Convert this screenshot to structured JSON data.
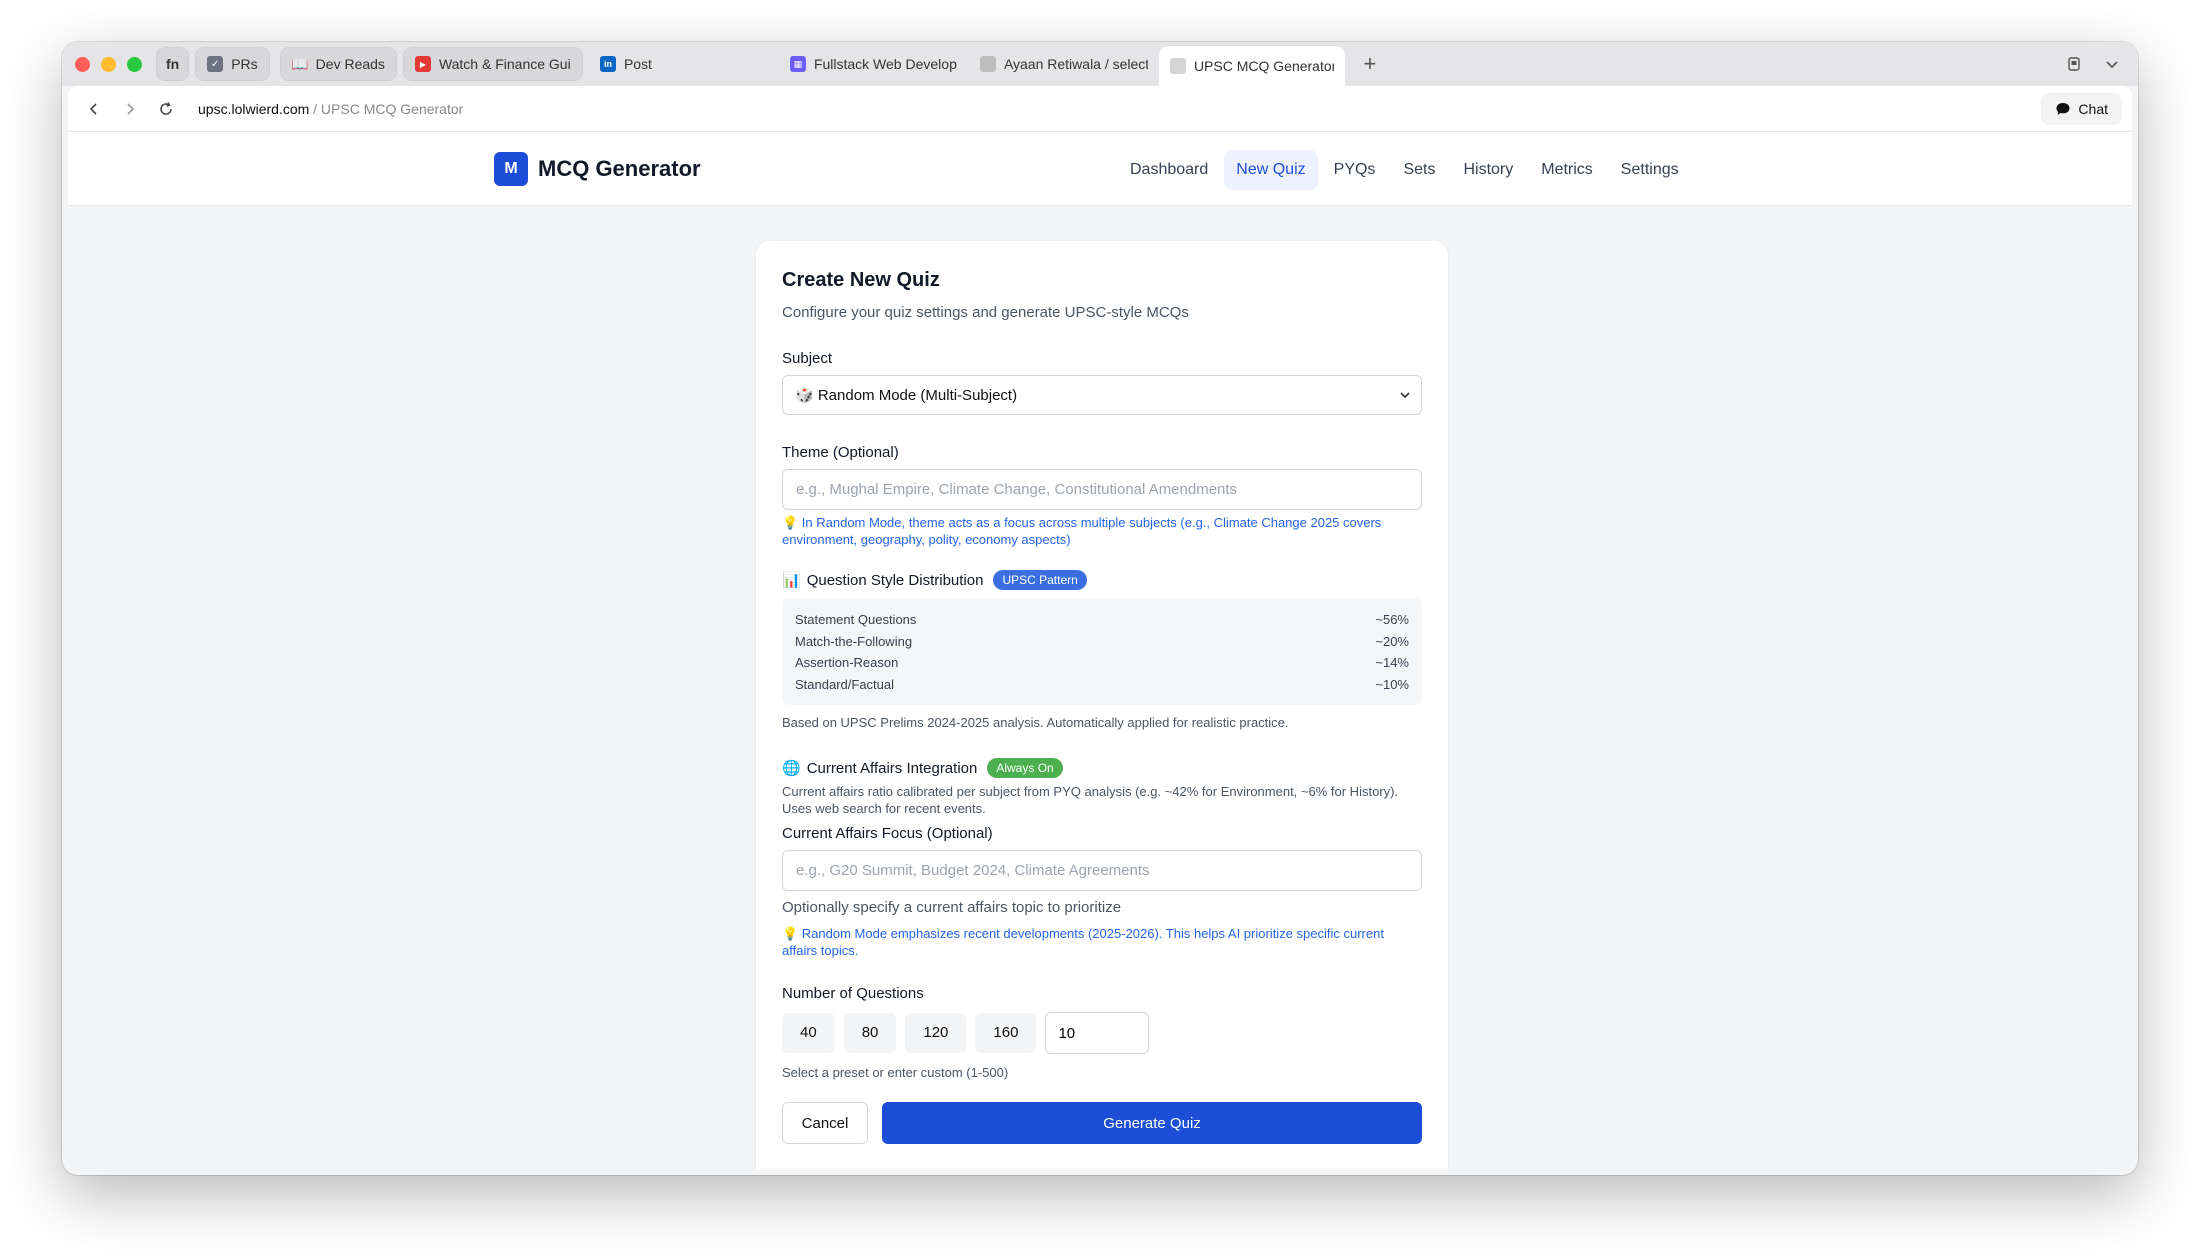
{
  "browser": {
    "tabs": [
      {
        "label": "fn",
        "pinned": true
      },
      {
        "label": "PRs",
        "pinned": true
      },
      {
        "label": "Dev Reads",
        "pinned": true
      },
      {
        "label": "Watch & Finance Guid",
        "pinned": true
      },
      {
        "label": "Post",
        "pinned": false
      },
      {
        "label": "Fullstack Web Develop",
        "pinned": false
      },
      {
        "label": "Ayaan Retiwala / select",
        "pinned": false
      },
      {
        "label": "UPSC MCQ Generator",
        "pinned": false,
        "active": true
      }
    ],
    "url_domain": "upsc.lolwierd.com",
    "url_path": " / UPSC MCQ Generator",
    "chat_label": "Chat"
  },
  "app": {
    "logo_letter": "M",
    "name": "MCQ Generator",
    "nav": [
      "Dashboard",
      "New Quiz",
      "PYQs",
      "Sets",
      "History",
      "Metrics",
      "Settings"
    ],
    "active_nav": "New Quiz"
  },
  "form": {
    "title": "Create New Quiz",
    "subtitle": "Configure your quiz settings and generate UPSC-style MCQs",
    "subject_label": "Subject",
    "subject_value": "🎲 Random Mode (Multi-Subject)",
    "theme_label": "Theme (Optional)",
    "theme_placeholder": "e.g., Mughal Empire, Climate Change, Constitutional Amendments",
    "theme_hint": "💡 In Random Mode, theme acts as a focus across multiple subjects (e.g., Climate Change 2025 covers environment, geography, polity, economy aspects)",
    "style_icon": "📊",
    "style_title": "Question Style Distribution",
    "style_badge": "UPSC Pattern",
    "distribution": [
      {
        "name": "Statement Questions",
        "pct": "~56%"
      },
      {
        "name": "Match-the-Following",
        "pct": "~20%"
      },
      {
        "name": "Assertion-Reason",
        "pct": "~14%"
      },
      {
        "name": "Standard/Factual",
        "pct": "~10%"
      }
    ],
    "style_note": "Based on UPSC Prelims 2024-2025 analysis. Automatically applied for realistic practice.",
    "ca_icon": "🌐",
    "ca_title": "Current Affairs Integration",
    "ca_badge": "Always On",
    "ca_note": "Current affairs ratio calibrated per subject from PYQ analysis (e.g. ~42% for Environment, ~6% for History). Uses web search for recent events.",
    "ca_focus_label": "Current Affairs Focus (Optional)",
    "ca_focus_placeholder": "e.g., G20 Summit, Budget 2024, Climate Agreements",
    "ca_focus_help": "Optionally specify a current affairs topic to prioritize",
    "ca_focus_hint": "💡 Random Mode emphasizes recent developments (2025-2026). This helps AI prioritize specific current affairs topics.",
    "num_label": "Number of Questions",
    "presets": [
      "40",
      "80",
      "120",
      "160"
    ],
    "custom_value": "10",
    "num_help": "Select a preset or enter custom (1-500)",
    "cancel_label": "Cancel",
    "generate_label": "Generate Quiz"
  },
  "colors": {
    "primary": "#1d4ed8",
    "badge_blue": "#3b6fe0",
    "badge_green": "#4caf50",
    "hint_blue": "#2563eb"
  }
}
